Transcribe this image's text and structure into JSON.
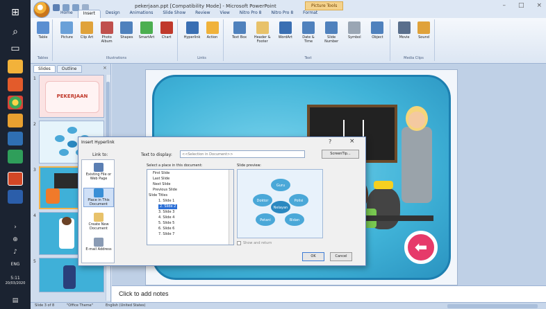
{
  "taskbar": {
    "time": "5:11",
    "date": "20/03/2020",
    "lang": "ENG"
  },
  "window": {
    "title": "pekerjaan.ppt [Compatibility Mode] - Microsoft PowerPoint",
    "picture_tools": "Picture Tools",
    "minimize": "–",
    "maximize": "□",
    "close": "×"
  },
  "tabs": [
    "Home",
    "Insert",
    "Design",
    "Animations",
    "Slide Show",
    "Review",
    "View",
    "Nitro Pro 8",
    "Nitro Pro 8",
    "Format"
  ],
  "active_tab": "Insert",
  "ribbon": {
    "groups": [
      {
        "label": "Tables",
        "buttons": [
          {
            "label": "Table",
            "color": "#5b8fd1"
          }
        ]
      },
      {
        "label": "Illustrations",
        "buttons": [
          {
            "label": "Picture",
            "color": "#6aa0d8"
          },
          {
            "label": "Clip Art",
            "color": "#e0a23a"
          },
          {
            "label": "Photo Album",
            "color": "#c0504d"
          },
          {
            "label": "Shapes",
            "color": "#4f81bd"
          },
          {
            "label": "SmartArt",
            "color": "#4caf50"
          },
          {
            "label": "Chart",
            "color": "#c0392b"
          }
        ]
      },
      {
        "label": "Links",
        "buttons": [
          {
            "label": "Hyperlink",
            "color": "#3a6fb3"
          },
          {
            "label": "Action",
            "color": "#f0b23a"
          }
        ]
      },
      {
        "label": "Text",
        "buttons": [
          {
            "label": "Text Box",
            "color": "#4f81bd"
          },
          {
            "label": "Header & Footer",
            "color": "#e8c26a"
          },
          {
            "label": "WordArt",
            "color": "#3a6fb3"
          },
          {
            "label": "Date & Time",
            "color": "#4f81bd"
          },
          {
            "label": "Slide Number",
            "color": "#4f81bd"
          },
          {
            "label": "Symbol",
            "color": "#9aa6b4"
          },
          {
            "label": "Object",
            "color": "#4f81bd"
          }
        ]
      },
      {
        "label": "Media Clips",
        "buttons": [
          {
            "label": "Movie",
            "color": "#5a6f8c"
          },
          {
            "label": "Sound",
            "color": "#e0a23a"
          }
        ]
      }
    ]
  },
  "slides_panel": {
    "tabs": [
      "Slides",
      "Outline"
    ],
    "close": "×",
    "slide1_title": "PEKERJAAN",
    "numbers": [
      "1",
      "2",
      "3",
      "4",
      "5"
    ]
  },
  "notes": {
    "placeholder": "Click to add notes"
  },
  "status": {
    "slide": "Slide 3 of 8",
    "theme": "\"Office Theme\"",
    "language": "English (United States)"
  },
  "dialog": {
    "title": "Insert Hyperlink",
    "help": "?",
    "close": "×",
    "link_to": "Link to:",
    "text_to_display_label": "Text to display:",
    "text_to_display_value": "<<Selection in Document>>",
    "screentip": "ScreenTip...",
    "place_label": "Select a place in this document:",
    "preview_label": "Slide preview:",
    "link_to_options": [
      {
        "label": "Existing File or Web Page",
        "color": "#5b7fb3"
      },
      {
        "label": "Place in This Document",
        "color": "#3a8fd6"
      },
      {
        "label": "Create New Document",
        "color": "#e8c26a"
      },
      {
        "label": "E-mail Address",
        "color": "#8a9bb4"
      }
    ],
    "tree": [
      "First Slide",
      "Last Slide",
      "Next Slide",
      "Previous Slide",
      "Slide Titles",
      "1. Slide 1",
      "2. Slide 2",
      "3. Slide 3",
      "4. Slide 4",
      "5. Slide 5",
      "6. Slide 6",
      "7. Slide 7"
    ],
    "selected_tree_item": "2. Slide 2",
    "preview_nodes": [
      "Guru",
      "Doktor",
      "Polisi",
      "Nelayan",
      "Petani",
      "Bidan"
    ],
    "show_and_return": "Show and return",
    "ok": "OK",
    "cancel": "Cancel"
  }
}
